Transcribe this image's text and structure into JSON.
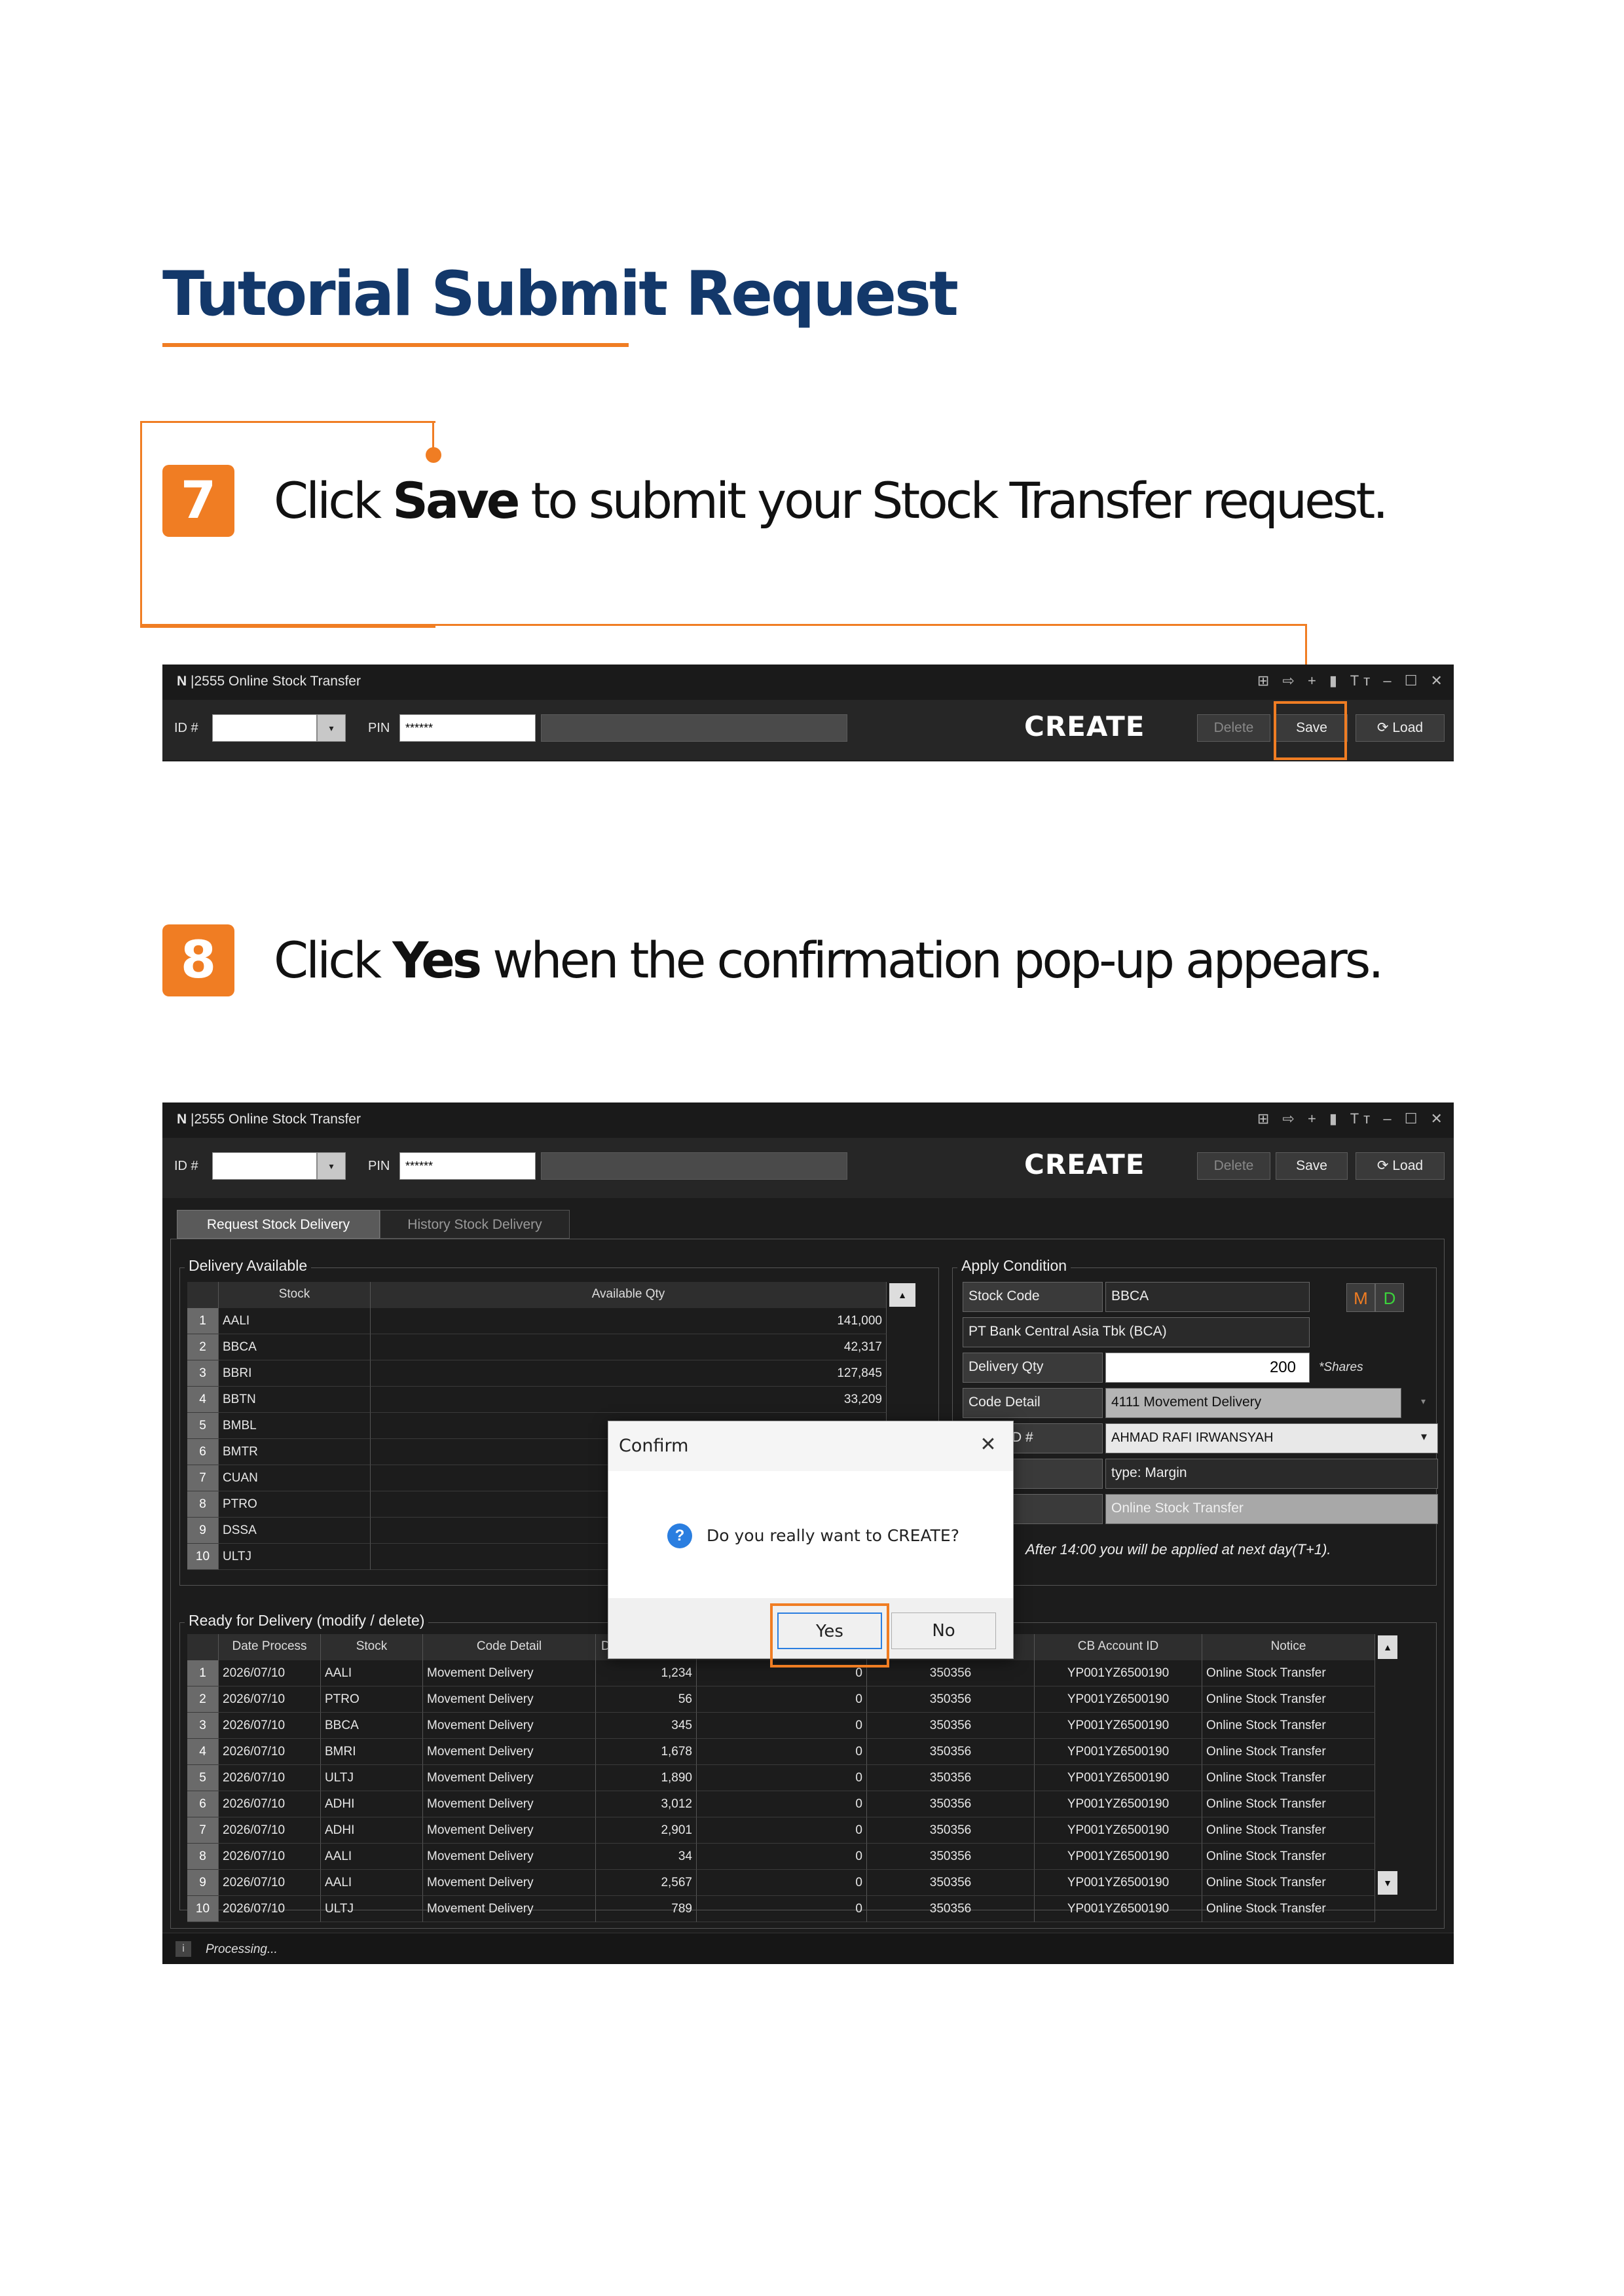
{
  "title": "Tutorial Submit Request",
  "step7": {
    "number": "7",
    "text_before": "Click ",
    "text_bold": "Save",
    "text_after": " to submit your Stock Transfer request."
  },
  "step8": {
    "number": "8",
    "text_before": "Click ",
    "text_bold": "Yes",
    "text_after": " when the confirmation pop-up appears."
  },
  "app": {
    "logo": "N",
    "window_code": "|2555",
    "window_title": "Online Stock Transfer",
    "window_controls": "⊞ ⇨ + ▮ Tт – ☐ ✕",
    "id_label": "ID #",
    "id_value": "",
    "dropdown_arrow": "▾",
    "pin_label": "PIN",
    "pin_value": "******",
    "mode_label": "CREATE",
    "delete_label": "Delete",
    "save_label": "Save",
    "load_label": "Load",
    "load_icon": "⟳"
  },
  "tabs": [
    "Request Stock Delivery",
    "History Stock Delivery"
  ],
  "delivery_available": {
    "title": "Delivery Available",
    "columns": [
      "Stock",
      "Available Qty"
    ],
    "rows": [
      {
        "no": "1",
        "stock": "AALI",
        "qty": "141,000"
      },
      {
        "no": "2",
        "stock": "BBCA",
        "qty": "42,317"
      },
      {
        "no": "3",
        "stock": "BBRI",
        "qty": "127,845"
      },
      {
        "no": "4",
        "stock": "BBTN",
        "qty": "33,209"
      },
      {
        "no": "5",
        "stock": "BMBL",
        "qty": ""
      },
      {
        "no": "6",
        "stock": "BMTR",
        "qty": ""
      },
      {
        "no": "7",
        "stock": "CUAN",
        "qty": ""
      },
      {
        "no": "8",
        "stock": "PTRO",
        "qty": ""
      },
      {
        "no": "9",
        "stock": "DSSA",
        "qty": ""
      },
      {
        "no": "10",
        "stock": "ULTJ",
        "qty": ""
      }
    ]
  },
  "apply_condition": {
    "title": "Apply Condition",
    "stock_code_label": "Stock Code",
    "stock_code_value": "BBCA",
    "company_name": "PT Bank Central Asia Tbk (BCA)",
    "delivery_qty_label": "Delivery Qty",
    "delivery_qty_value": "200",
    "shares_note": "*Shares",
    "code_detail_label": "Code Detail",
    "code_detail_value": "4111 Movement Delivery",
    "id_label_partial": "D #",
    "id_value": "AHMAD RAFI IRWANSYAH",
    "type_value": "type: Margin",
    "notice_value": "Online Stock Transfer",
    "m_label": "M",
    "d_label": "D",
    "after_note": "After 14:00 you will be applied at next day(T+1)."
  },
  "ready_for_delivery": {
    "title": "Ready for Delivery (modify / delete)",
    "columns": [
      "Date Process",
      "Stock",
      "Code Detail",
      "D",
      "",
      "D#",
      "CB Account ID",
      "Notice"
    ],
    "rows": [
      {
        "no": "1",
        "date": "2026/07/10",
        "stock": "AALI",
        "code": "Movement Delivery",
        "qty": "1,234",
        "done": "0",
        "acct": "350356",
        "cb": "YP001YZ6500190",
        "notice": "Online Stock Transfer"
      },
      {
        "no": "2",
        "date": "2026/07/10",
        "stock": "PTRO",
        "code": "Movement Delivery",
        "qty": "56",
        "done": "0",
        "acct": "350356",
        "cb": "YP001YZ6500190",
        "notice": "Online Stock Transfer"
      },
      {
        "no": "3",
        "date": "2026/07/10",
        "stock": "BBCA",
        "code": "Movement Delivery",
        "qty": "345",
        "done": "0",
        "acct": "350356",
        "cb": "YP001YZ6500190",
        "notice": "Online Stock Transfer"
      },
      {
        "no": "4",
        "date": "2026/07/10",
        "stock": "BMRI",
        "code": "Movement Delivery",
        "qty": "1,678",
        "done": "0",
        "acct": "350356",
        "cb": "YP001YZ6500190",
        "notice": "Online Stock Transfer"
      },
      {
        "no": "5",
        "date": "2026/07/10",
        "stock": "ULTJ",
        "code": "Movement Delivery",
        "qty": "1,890",
        "done": "0",
        "acct": "350356",
        "cb": "YP001YZ6500190",
        "notice": "Online Stock Transfer"
      },
      {
        "no": "6",
        "date": "2026/07/10",
        "stock": "ADHI",
        "code": "Movement Delivery",
        "qty": "3,012",
        "done": "0",
        "acct": "350356",
        "cb": "YP001YZ6500190",
        "notice": "Online Stock Transfer"
      },
      {
        "no": "7",
        "date": "2026/07/10",
        "stock": "ADHI",
        "code": "Movement Delivery",
        "qty": "2,901",
        "done": "0",
        "acct": "350356",
        "cb": "YP001YZ6500190",
        "notice": "Online Stock Transfer"
      },
      {
        "no": "8",
        "date": "2026/07/10",
        "stock": "AALI",
        "code": "Movement Delivery",
        "qty": "34",
        "done": "0",
        "acct": "350356",
        "cb": "YP001YZ6500190",
        "notice": "Online Stock Transfer"
      },
      {
        "no": "9",
        "date": "2026/07/10",
        "stock": "AALI",
        "code": "Movement Delivery",
        "qty": "2,567",
        "done": "0",
        "acct": "350356",
        "cb": "YP001YZ6500190",
        "notice": "Online Stock Transfer"
      },
      {
        "no": "10",
        "date": "2026/07/10",
        "stock": "ULTJ",
        "code": "Movement Delivery",
        "qty": "789",
        "done": "0",
        "acct": "350356",
        "cb": "YP001YZ6500190",
        "notice": "Online Stock Transfer"
      }
    ]
  },
  "status": {
    "icon": "i",
    "text": "Processing..."
  },
  "dialog": {
    "title": "Confirm",
    "close": "✕",
    "icon": "?",
    "message": "Do you really want to CREATE?",
    "yes_label": "Yes",
    "no_label": "No"
  },
  "colors": {
    "accent": "#f07d23",
    "title_navy": "#13386a",
    "window_bg": "#1c1c1c",
    "m_color": "#f07d23",
    "d_color": "#3cd23c",
    "question_blue": "#2a7ee0"
  }
}
